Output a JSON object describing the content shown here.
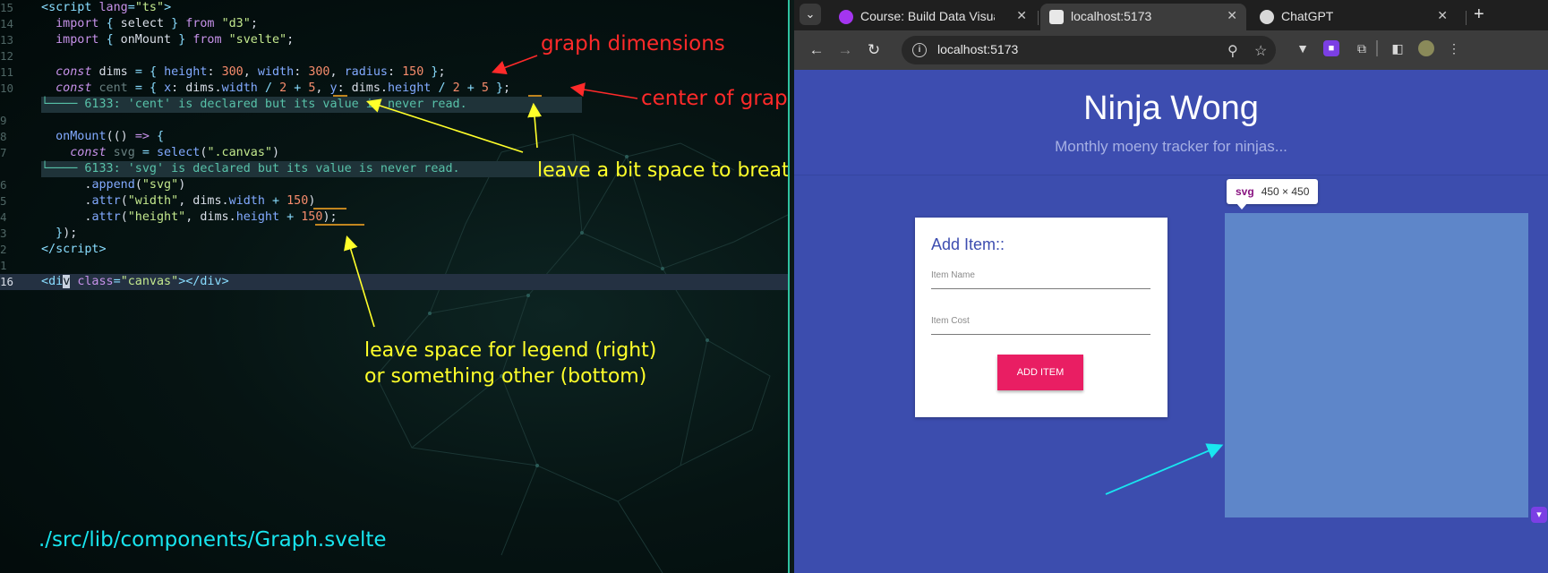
{
  "editor": {
    "lines": [
      {
        "n": "15",
        "html": "<span class=\"punc\">&lt;</span><span class=\"tag\">script</span> <span class=\"kw\">lang</span><span class=\"punc\">=</span><span class=\"str\">\"ts\"</span><span class=\"punc\">&gt;</span>"
      },
      {
        "n": "14",
        "html": "  <span class=\"kw\">import</span> <span class=\"punc\">{</span> select <span class=\"punc\">}</span> <span class=\"kw\">from</span> <span class=\"str\">\"d3\"</span>;"
      },
      {
        "n": "13",
        "html": "  <span class=\"kw\">import</span> <span class=\"punc\">{</span> onMount <span class=\"punc\">}</span> <span class=\"kw\">from</span> <span class=\"str\">\"svelte\"</span>;"
      },
      {
        "n": "12",
        "html": ""
      },
      {
        "n": "11",
        "html": "  <span class=\"kwi\">const</span> dims <span class=\"punc\">=</span> <span class=\"punc\">{</span> <span class=\"prop\">height</span>: <span class=\"num\">300</span>, <span class=\"prop\">width</span>: <span class=\"num\">300</span>, <span class=\"prop\">radius</span>: <span class=\"num\">150</span> <span class=\"punc\">}</span>;"
      },
      {
        "n": "10",
        "html": "  <span class=\"kwi\">const</span> <span class=\"dim\">cent</span> <span class=\"punc\">=</span> <span class=\"punc\">{</span> <span class=\"prop\">x</span>: dims.<span class=\"prop\">width</span> <span class=\"punc\">/</span> <span class=\"num\">2</span> <span class=\"punc\">+</span> <span class=\"num\">5</span>, <span class=\"prop\">y</span>: dims.<span class=\"prop\">height</span> <span class=\"punc\">/</span> <span class=\"num\">2</span> <span class=\"punc\">+</span> <span class=\"num\">5</span> <span class=\"punc\">}</span>;"
      },
      {
        "n": "",
        "html": ""
      },
      {
        "n": "9",
        "html": ""
      },
      {
        "n": "8",
        "html": "  <span class=\"fn\">onMount</span>(() <span class=\"kw\">=&gt;</span> <span class=\"punc\">{</span>"
      },
      {
        "n": "7",
        "html": "    <span class=\"kwi\">const</span> <span class=\"dim\">svg</span> <span class=\"punc\">=</span> <span class=\"fn\">select</span>(<span class=\"str\">\".canvas\"</span>)"
      },
      {
        "n": "",
        "html": ""
      },
      {
        "n": "6",
        "html": "      .<span class=\"fn\">append</span>(<span class=\"str\">\"svg\"</span>)"
      },
      {
        "n": "5",
        "html": "      .<span class=\"fn\">attr</span>(<span class=\"str\">\"width\"</span>, dims.<span class=\"prop\">width</span> <span class=\"punc\">+</span> <span class=\"num\">150</span>)"
      },
      {
        "n": "4",
        "html": "      .<span class=\"fn\">attr</span>(<span class=\"str\">\"height\"</span>, dims.<span class=\"prop\">height</span> <span class=\"punc\">+</span> <span class=\"num\">150</span>);"
      },
      {
        "n": "3",
        "html": "  <span class=\"punc\">}</span>);"
      },
      {
        "n": "2",
        "html": "<span class=\"punc\">&lt;/</span><span class=\"tag\">script</span><span class=\"punc\">&gt;</span>"
      },
      {
        "n": "1",
        "html": ""
      },
      {
        "n": "16",
        "html": "<span class=\"punc\">&lt;</span><span class=\"tag\">di<span class=\"cursor\">v</span></span> <span class=\"kw\">class</span><span class=\"punc\">=</span><span class=\"str\">\"canvas\"</span><span class=\"punc\">&gt;&lt;/</span><span class=\"tag\">div</span><span class=\"punc\">&gt;</span>",
        "current": true
      }
    ],
    "diagnostics": {
      "cent": "└──── 6133: 'cent' is declared but its value is never read.",
      "svg": "└──── 6133: 'svg' is declared but its value is never read."
    }
  },
  "annotations": {
    "graph_dimensions": "graph dimensions",
    "center_of_graph": "center of graph",
    "leave_space_breath": "leave a bit space to breath",
    "legend_line1": "leave space for legend (right)",
    "legend_line2": "or something other (bottom)",
    "file_path": "./src/lib/components/Graph.svelte"
  },
  "browser": {
    "tabs": [
      {
        "title": "Course: Build Data Visua",
        "favicon": "udemy-icon",
        "color": "#a435f0",
        "active": false
      },
      {
        "title": "localhost:5173",
        "favicon": "svelte-icon",
        "color": "#e8e8e8",
        "active": true
      },
      {
        "title": "ChatGPT",
        "favicon": "chatgpt-icon",
        "color": "#d8d8d8",
        "active": false
      }
    ],
    "url": "localhost:5173",
    "close_glyph": "✕",
    "new_tab_glyph": "+"
  },
  "site": {
    "title": "Ninja Wong",
    "subtitle": "Monthly moeny tracker for ninjas...",
    "card_title": "Add Item::",
    "item_name_placeholder": "Item Name",
    "item_cost_placeholder": "Item Cost",
    "add_button": "ADD ITEM",
    "svg_tooltip_name": "svg",
    "svg_tooltip_dims": "450 × 450"
  }
}
